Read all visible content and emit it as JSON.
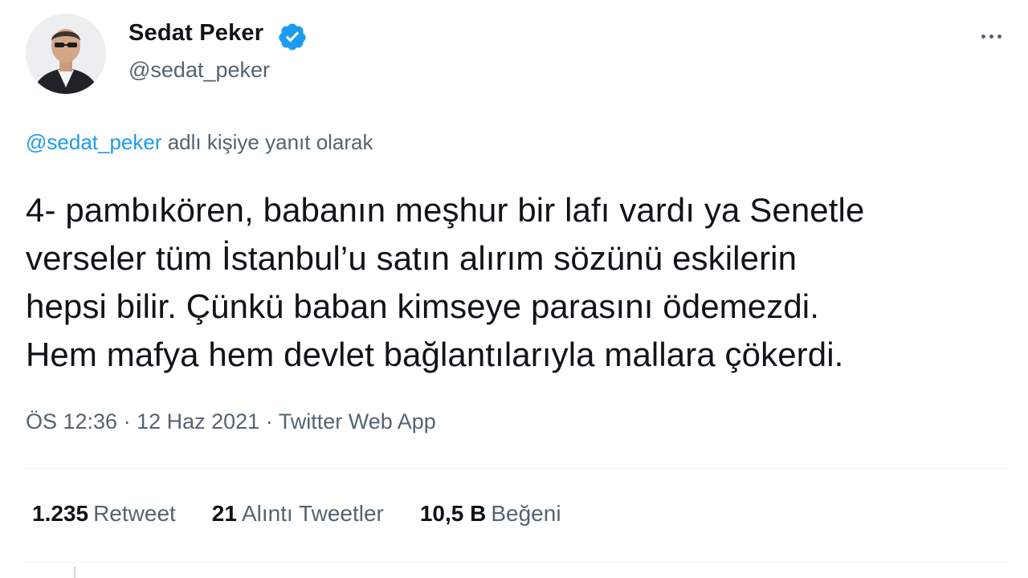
{
  "author": {
    "display_name": "Sedat Peker",
    "handle": "@sedat_peker",
    "verified": true
  },
  "reply_context": {
    "mention": "@sedat_peker",
    "text": " adlı kişiye yanıt olarak"
  },
  "tweet": {
    "text": "4- pambıkören, babanın meşhur bir lafı vardı ya Senetle\nverseler tüm İstanbul’u satın alırım sözünü eskilerin\nhepsi bilir. Çünkü baban kimseye parasını ödemezdi.\nHem mafya hem devlet bağlantılarıyla mallara çökerdi."
  },
  "meta": {
    "time": "ÖS 12:36",
    "separator": " · ",
    "date": "12 Haz 2021",
    "source": "Twitter Web App"
  },
  "stats": {
    "retweets": {
      "count": "1.235",
      "label": "Retweet"
    },
    "quotes": {
      "count": "21",
      "label": "Alıntı Tweetler"
    },
    "likes": {
      "count": "10,5 B",
      "label": "Beğeni"
    }
  },
  "colors": {
    "accent": "#1d9bf0",
    "text": "#0f1419",
    "secondary": "#536471"
  },
  "icons": {
    "verified": "verified-badge-icon",
    "more": "more-options-icon"
  }
}
